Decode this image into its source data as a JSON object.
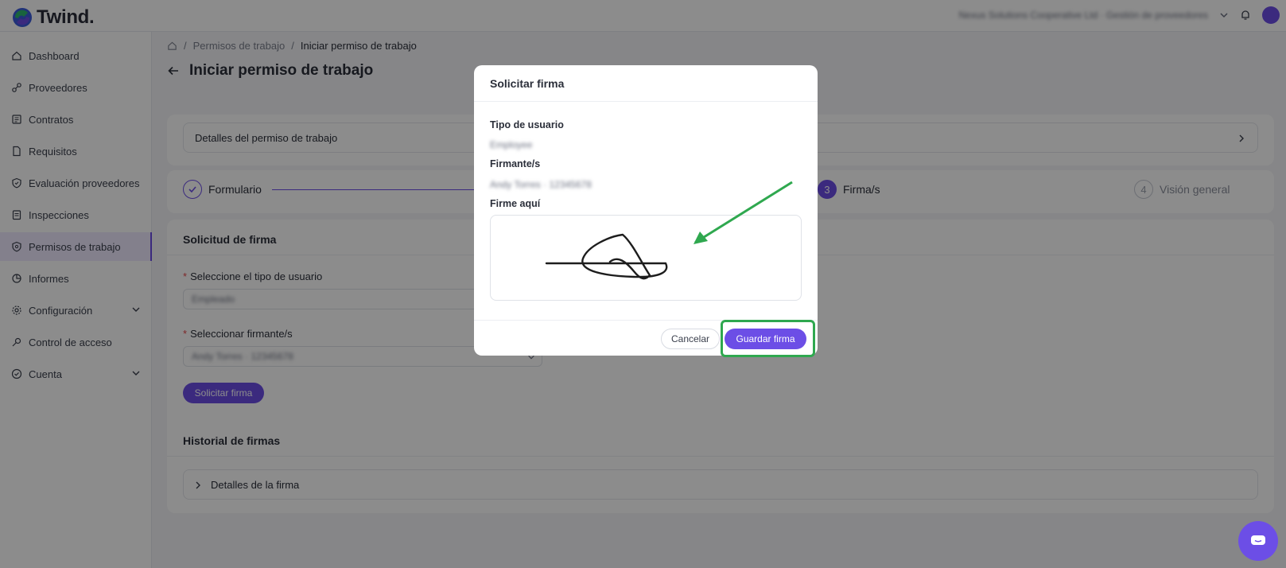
{
  "app": {
    "name": "Twind."
  },
  "header": {
    "org_text": "Nexus Solutions Cooperative Ltd · Gestión de proveedores",
    "colors": {
      "accent": "#6c4ee6"
    }
  },
  "sidebar": {
    "items": [
      {
        "label": "Dashboard",
        "icon": "home-icon"
      },
      {
        "label": "Proveedores",
        "icon": "link-icon"
      },
      {
        "label": "Contratos",
        "icon": "contract-icon"
      },
      {
        "label": "Requisitos",
        "icon": "document-icon"
      },
      {
        "label": "Evaluación proveedores",
        "icon": "shield-check-icon"
      },
      {
        "label": "Inspecciones",
        "icon": "clipboard-icon"
      },
      {
        "label": "Permisos de trabajo",
        "icon": "shield-icon",
        "active": true
      },
      {
        "label": "Informes",
        "icon": "chart-pie-icon"
      },
      {
        "label": "Configuración",
        "icon": "gear-icon",
        "expandable": true
      },
      {
        "label": "Control de acceso",
        "icon": "key-icon"
      },
      {
        "label": "Cuenta",
        "icon": "user-check-icon",
        "expandable": true
      }
    ]
  },
  "breadcrumb": {
    "sep": "/",
    "items": [
      "Permisos de trabajo",
      "Iniciar permiso de trabajo"
    ]
  },
  "page": {
    "title": "Iniciar permiso de trabajo"
  },
  "details": {
    "label": "Detalles del permiso de trabajo"
  },
  "steps": [
    {
      "label": "Formulario",
      "state": "done"
    },
    {
      "number": "3",
      "label": "Firma/s",
      "state": "current"
    },
    {
      "number": "4",
      "label": "Visión general",
      "state": "pending"
    }
  ],
  "signature_request": {
    "title": "Solicitud de firma",
    "user_type_label": "Seleccione el tipo de usuario",
    "user_type_value": "Empleado",
    "signer_label": "Seleccionar firmante/s",
    "signer_value": "Andy Torres · 12345678",
    "button": "Solicitar firma"
  },
  "history": {
    "title": "Historial de firmas",
    "row_label": "Detalles de la firma"
  },
  "modal": {
    "title": "Solicitar firma",
    "user_type_label": "Tipo de usuario",
    "user_type_value": "Employee",
    "signer_label": "Firmante/s",
    "signer_value": "Andy Torres · 12345678",
    "sign_here_label": "Firme aquí",
    "cancel": "Cancelar",
    "save": "Guardar firma"
  }
}
